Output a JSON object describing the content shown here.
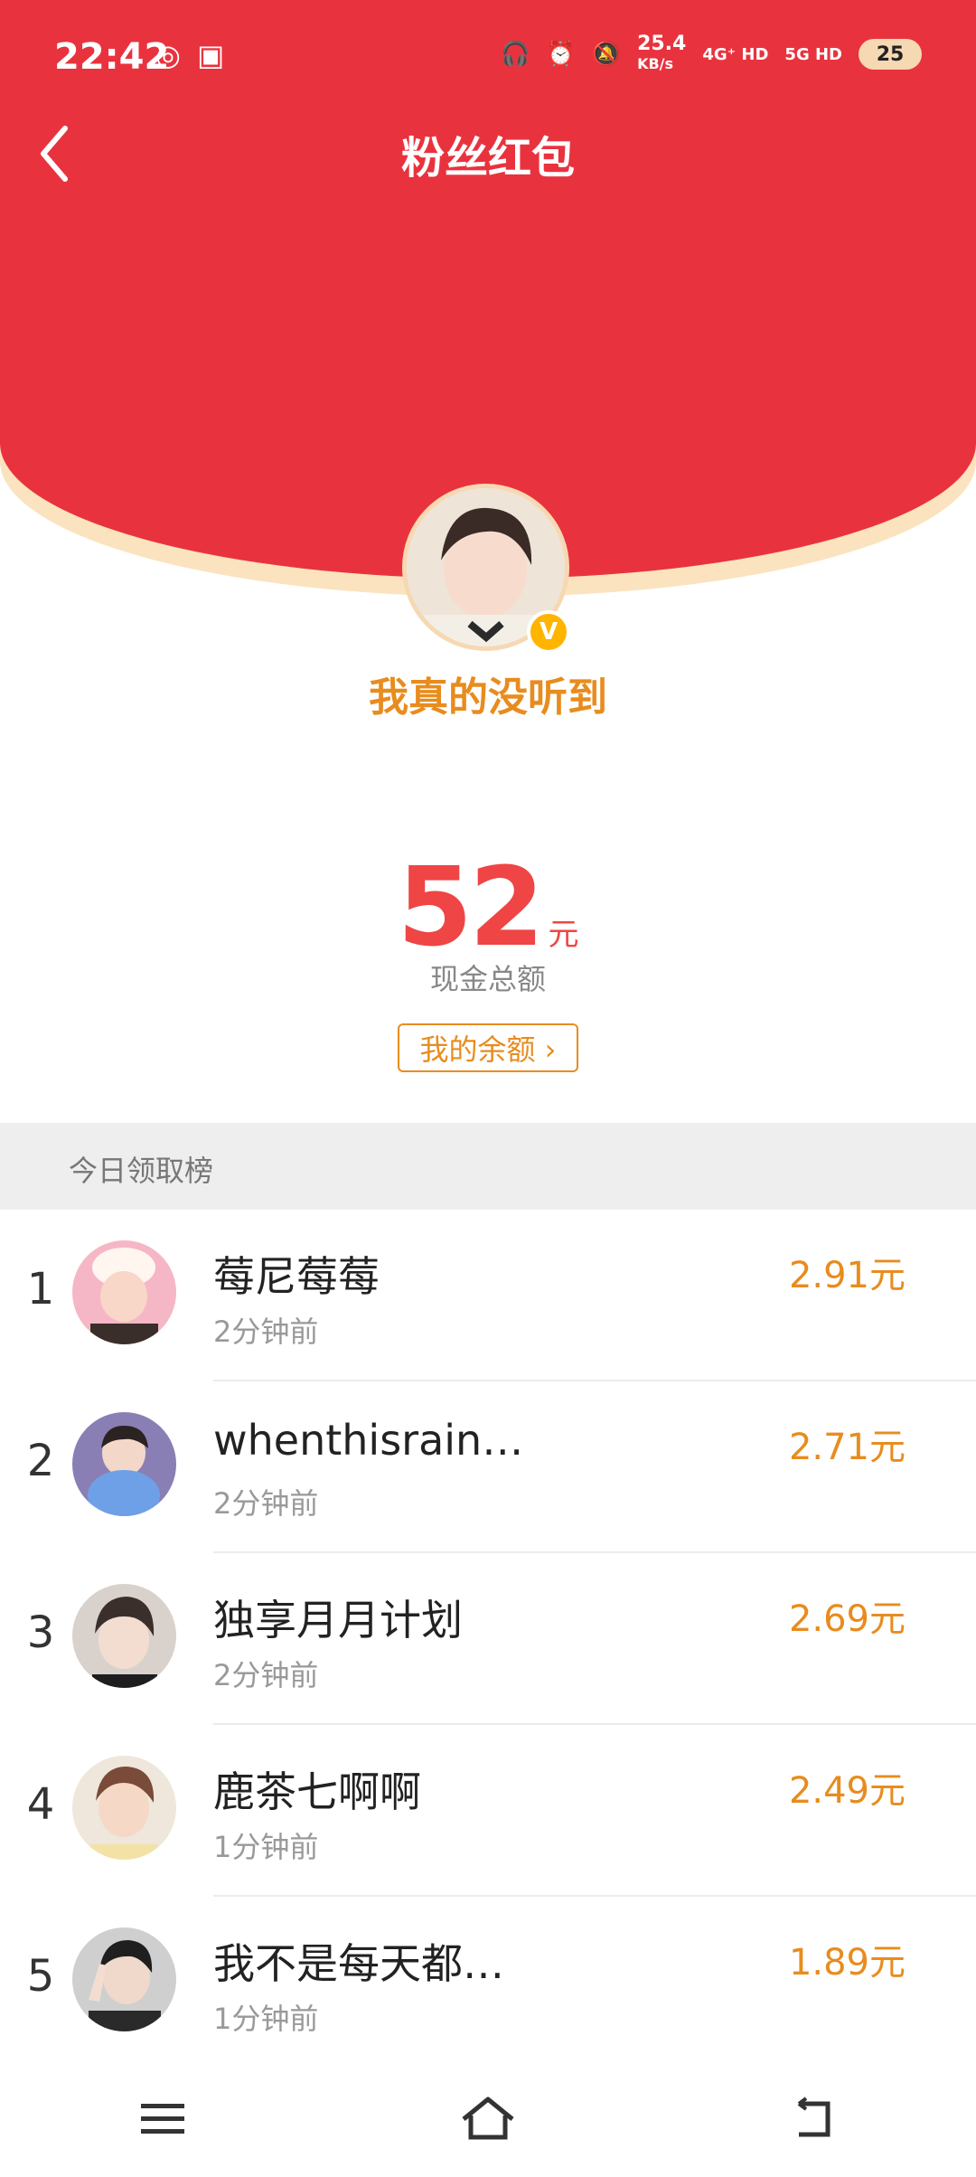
{
  "status_bar": {
    "time": "22:42",
    "net_speed": "25.4",
    "net_unit": "KB/s",
    "signal1": "4G⁺ HD",
    "signal2": "5G HD",
    "battery": "25"
  },
  "header": {
    "title": "粉丝红包"
  },
  "profile": {
    "username": "我真的没听到",
    "verified_badge": "V"
  },
  "summary": {
    "amount": "52",
    "unit": "元",
    "label": "现金总额",
    "balance_button": "我的余额 ›"
  },
  "section": {
    "title": "今日领取榜"
  },
  "leaderboard": [
    {
      "rank": "1",
      "name": "莓尼莓莓",
      "time": "2分钟前",
      "amount": "2.91元",
      "avatar_color": "#f5b7c5"
    },
    {
      "rank": "2",
      "name": "whenthisrain…",
      "time": "2分钟前",
      "amount": "2.71元",
      "avatar_color": "#6c8fd6"
    },
    {
      "rank": "3",
      "name": "独享月月计划",
      "time": "2分钟前",
      "amount": "2.69元",
      "avatar_color": "#5b4a45"
    },
    {
      "rank": "4",
      "name": "鹿茶七啊啊",
      "time": "1分钟前",
      "amount": "2.49元",
      "avatar_color": "#c9a48b"
    },
    {
      "rank": "5",
      "name": "我不是每天都…",
      "time": "1分钟前",
      "amount": "1.89元",
      "avatar_color": "#3b3b3b"
    }
  ],
  "colors": {
    "header_red": "#e8333e",
    "accent_orange": "#e88c1e",
    "amount_red": "#ef4545"
  }
}
